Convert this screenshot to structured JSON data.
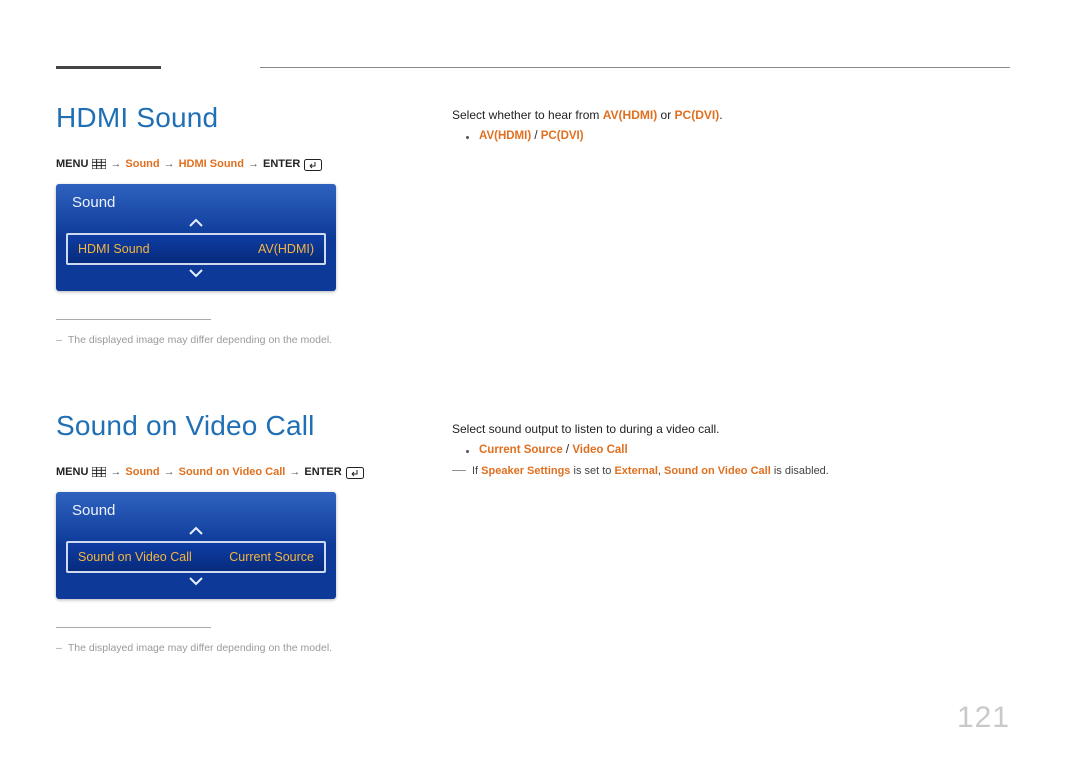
{
  "page_number": "121",
  "section1": {
    "title": "HDMI Sound",
    "breadcrumb": {
      "menu": "MENU",
      "lvl1": "Sound",
      "lvl2": "HDMI Sound",
      "enter": "ENTER"
    },
    "osd": {
      "title": "Sound",
      "item_label": "HDMI Sound",
      "item_value": "AV(HDMI)"
    },
    "note": "The displayed image may differ depending on the model.",
    "right": {
      "intro_before": "Select whether to hear from ",
      "opt1": "AV(HDMI)",
      "intro_mid": " or ",
      "opt2": "PC(DVI)",
      "intro_after": ".",
      "bullet_a": "AV(HDMI)",
      "bullet_sep": " / ",
      "bullet_b": "PC(DVI)"
    }
  },
  "section2": {
    "title": "Sound on Video Call",
    "breadcrumb": {
      "menu": "MENU",
      "lvl1": "Sound",
      "lvl2": "Sound on Video Call",
      "enter": "ENTER"
    },
    "osd": {
      "title": "Sound",
      "item_label": "Sound on Video Call",
      "item_value": "Current Source"
    },
    "note": "The displayed image may differ depending on the model.",
    "right": {
      "intro": "Select sound output to listen to during a video call.",
      "bullet_a": "Current Source",
      "bullet_sep": " / ",
      "bullet_b": "Video Call",
      "foot_before": "If ",
      "foot_b1": "Speaker Settings",
      "foot_mid1": " is set to ",
      "foot_b2": "External",
      "foot_mid2": ", ",
      "foot_b3": "Sound on Video Call",
      "foot_after": " is disabled."
    }
  }
}
